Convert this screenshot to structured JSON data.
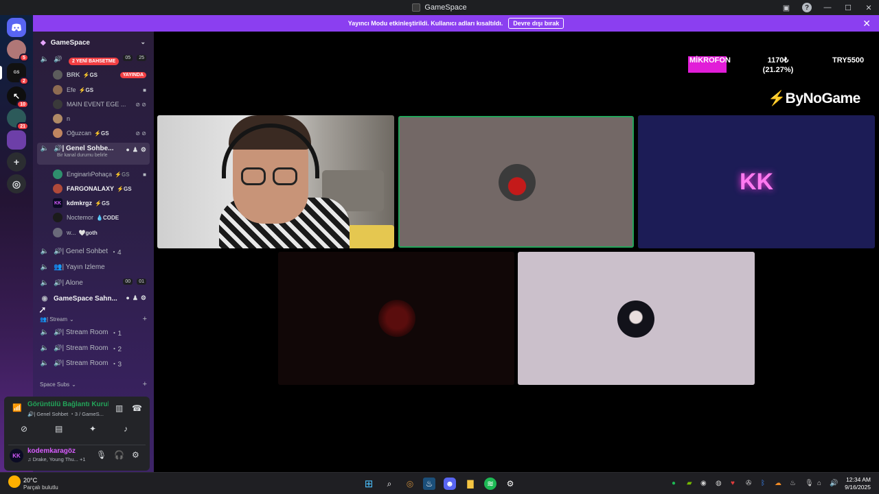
{
  "window": {
    "title": "GameSpace"
  },
  "notice": {
    "text": "Yayıncı Modu etkinleştirildi. Kullanıcı adları kısaltıldı.",
    "button": "Devre dışı bırak"
  },
  "rail": {
    "badges": [
      "5",
      "2",
      "10",
      "21"
    ]
  },
  "sidebar": {
    "server_name": "GameSpace",
    "mention_badge": "2 YENİ BAHSETME",
    "top_channel": {
      "counts": [
        "05",
        "25"
      ]
    },
    "users_a": [
      {
        "name": "BRK",
        "tag": "⚡GS",
        "live": "YAYINDA"
      },
      {
        "name": "Efe",
        "tag": "⚡GS"
      },
      {
        "name": "MAIN EVENT EGE ...",
        "tag": ""
      },
      {
        "name": "n",
        "tag": ""
      },
      {
        "name": "Oğuzcan",
        "tag": "⚡GS"
      }
    ],
    "active_channel": {
      "name": "🔊| Genel Sohbe...",
      "status": "Bir kanal durumu belirle"
    },
    "users_b": [
      {
        "name": "EnginarlıPohaça",
        "tag": "⚡GS"
      },
      {
        "name": "FARGONALAXY",
        "tag": "⚡GS"
      },
      {
        "name": "kdmkrgz",
        "tag": "⚡GS"
      },
      {
        "name": "Noctemor",
        "tag": "💧CODE"
      },
      {
        "name": "w...",
        "tag": "🤍goth"
      }
    ],
    "channels": [
      {
        "name": "🔊| Genel Sohbet",
        "count": "4"
      },
      {
        "name": "👥| Yayın İzleme",
        "count": ""
      },
      {
        "name": "🔊| Alone",
        "count": ""
      }
    ],
    "alone_counts": [
      "00",
      "01"
    ],
    "stage_channel": "GameSpace Sahn...",
    "category_stream": "👥| Stream",
    "stream_rooms": [
      {
        "name": "🔊| Stream Room",
        "count": "1"
      },
      {
        "name": "🔊| Stream Room",
        "count": "2"
      },
      {
        "name": "🔊| Stream Room",
        "count": "3"
      }
    ],
    "category_subs": "Space Subs"
  },
  "voice": {
    "status": "Görüntülü Bağlantı Kuruldu",
    "channel": "🔊| Genel Sohbet ・3 / GameS...",
    "username": "kodemkaragöz",
    "activity": "♫ Drake, Young Thu... +1",
    "avatar_initials": "KK"
  },
  "stage": {
    "mic_label": "MİKROFON",
    "amount": "1170₺",
    "percent": "(21.27%)",
    "goal": "TRY5500",
    "brand": "ByNoGame",
    "tile_initials": "KK"
  },
  "taskbar": {
    "temp": "20°C",
    "condition": "Parçalı bulutlu",
    "time": "12:34 AM",
    "date": "9/16/2025"
  },
  "colors": {
    "accent": "#8b3ff0",
    "live": "#f23f43",
    "connected": "#23a55a",
    "overlay": "#e11dd8"
  }
}
